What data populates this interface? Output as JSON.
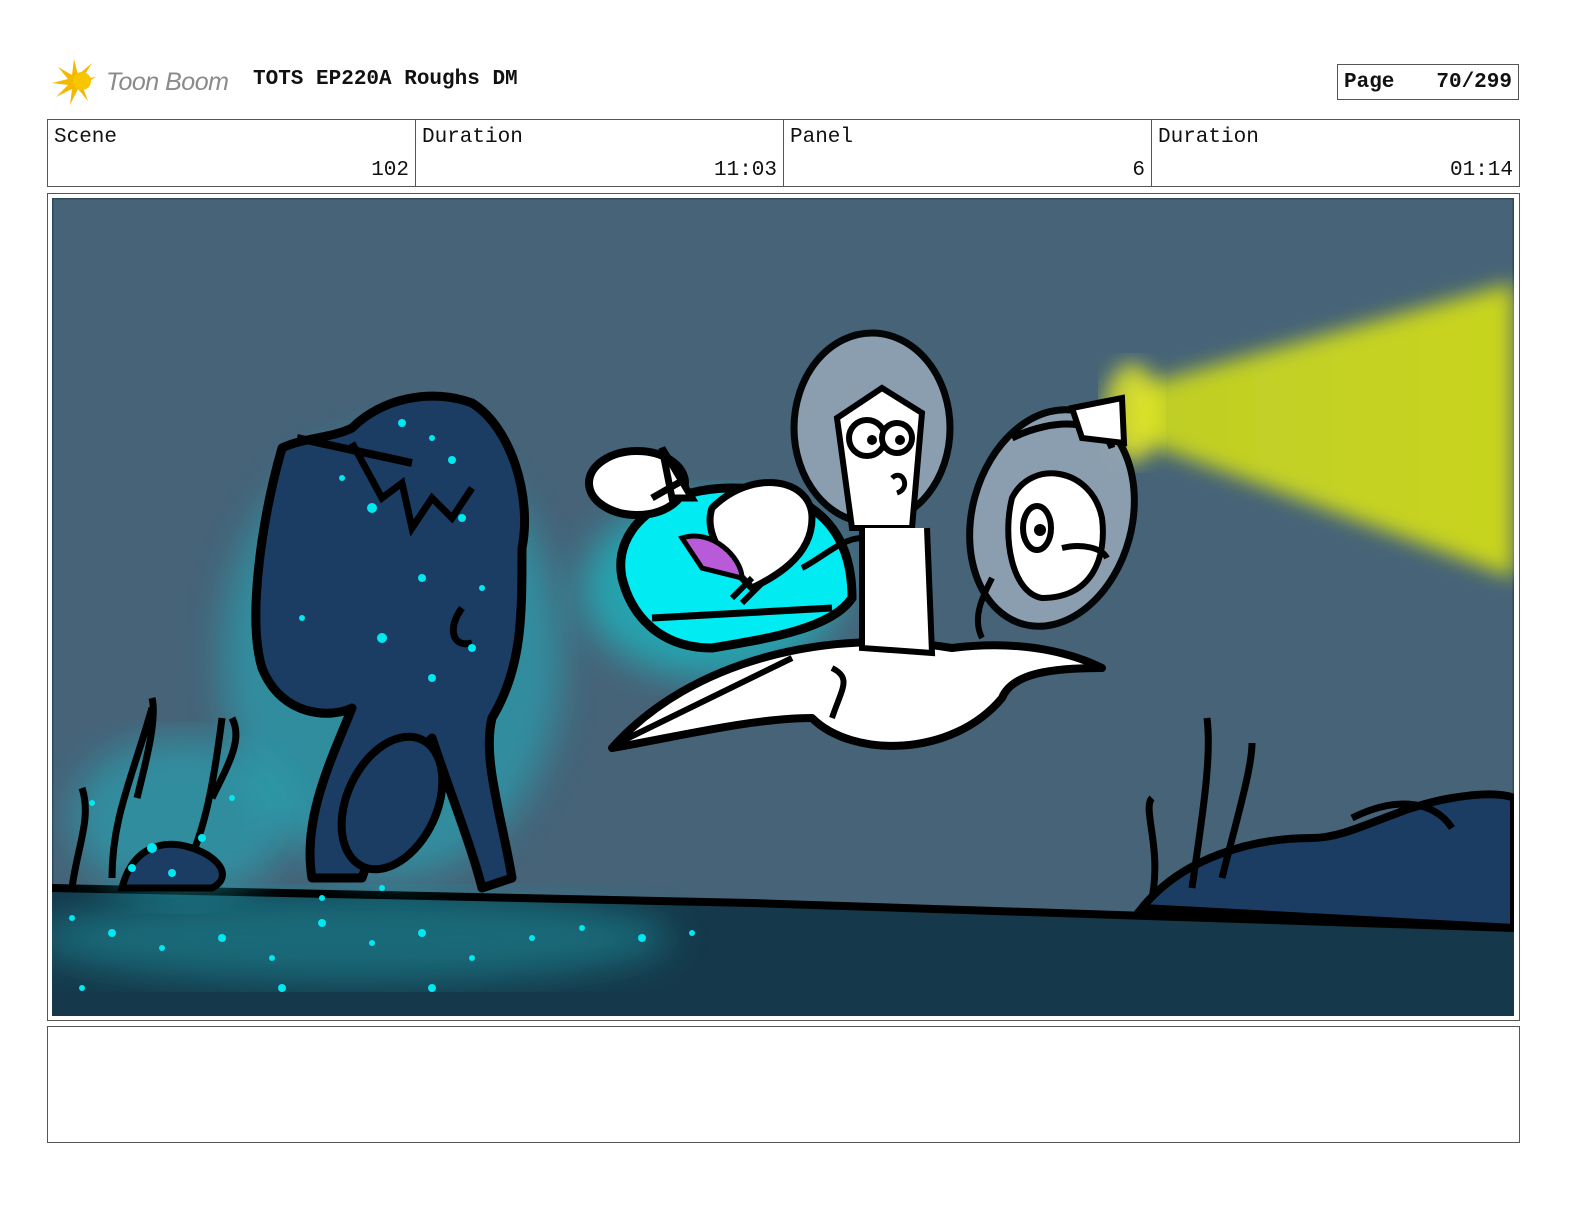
{
  "header": {
    "logo_text": "Toon Boom",
    "title": "TOTS EP220A Roughs DM",
    "page_label": "Page",
    "page_value": "70/299"
  },
  "info": {
    "scene_label": "Scene",
    "scene_value": "102",
    "scene_duration_label": "Duration",
    "scene_duration_value": "11:03",
    "panel_label": "Panel",
    "panel_value": "6",
    "panel_duration_label": "Duration",
    "panel_duration_value": "01:14"
  },
  "panel": {
    "background_color": "#466378",
    "seafloor_color": "#15394a",
    "glow_color": "#00f0f0",
    "light_beam_color": "#d4e01a"
  },
  "notes": {
    "text": ""
  }
}
